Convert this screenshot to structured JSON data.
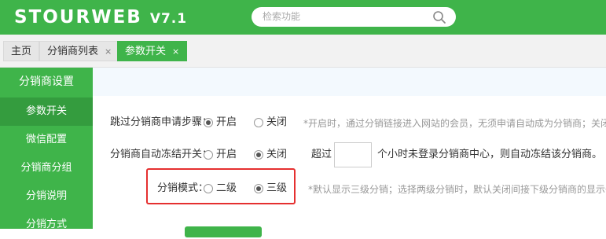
{
  "header": {
    "logo": "STOURWEB",
    "version": "V7.1",
    "search_placeholder": "检索功能",
    "brand_color": "#3fb44a"
  },
  "tabs": [
    {
      "label": "主页",
      "closable": false,
      "active": false
    },
    {
      "label": "分销商列表",
      "closable": true,
      "active": false
    },
    {
      "label": "参数开关",
      "closable": true,
      "active": true
    }
  ],
  "tab_close_glyph": "×",
  "sidebar": {
    "heading": "分销商设置",
    "items": [
      {
        "label": "参数开关",
        "active": true
      },
      {
        "label": "微信配置",
        "active": false
      },
      {
        "label": "分销商分组",
        "active": false
      },
      {
        "label": "分销说明",
        "active": false
      },
      {
        "label": "分销方式",
        "active": false
      }
    ]
  },
  "settings": {
    "skip_steps": {
      "label": "跳过分销商申请步骤：",
      "options": [
        "开启",
        "关闭"
      ],
      "selected": "开启",
      "hint": "*开启时，通过分销链接进入网站的会员，无须申请自动成为分销商；关闭"
    },
    "auto_freeze": {
      "label": "分销商自动冻结开关：",
      "options": [
        "开启",
        "关闭"
      ],
      "selected": "关闭",
      "prefix": "超过",
      "value": "",
      "suffix": "个小时未登录分销商中心，则自动冻结该分销商。"
    },
    "mode": {
      "label": "分销模式：",
      "options": [
        "二级",
        "三级"
      ],
      "selected": "三级",
      "hint": "*默认显示三级分销；选择两级分销时，默认关闭间接下级分销商的显示一"
    }
  },
  "highlight_color": "#e53030"
}
